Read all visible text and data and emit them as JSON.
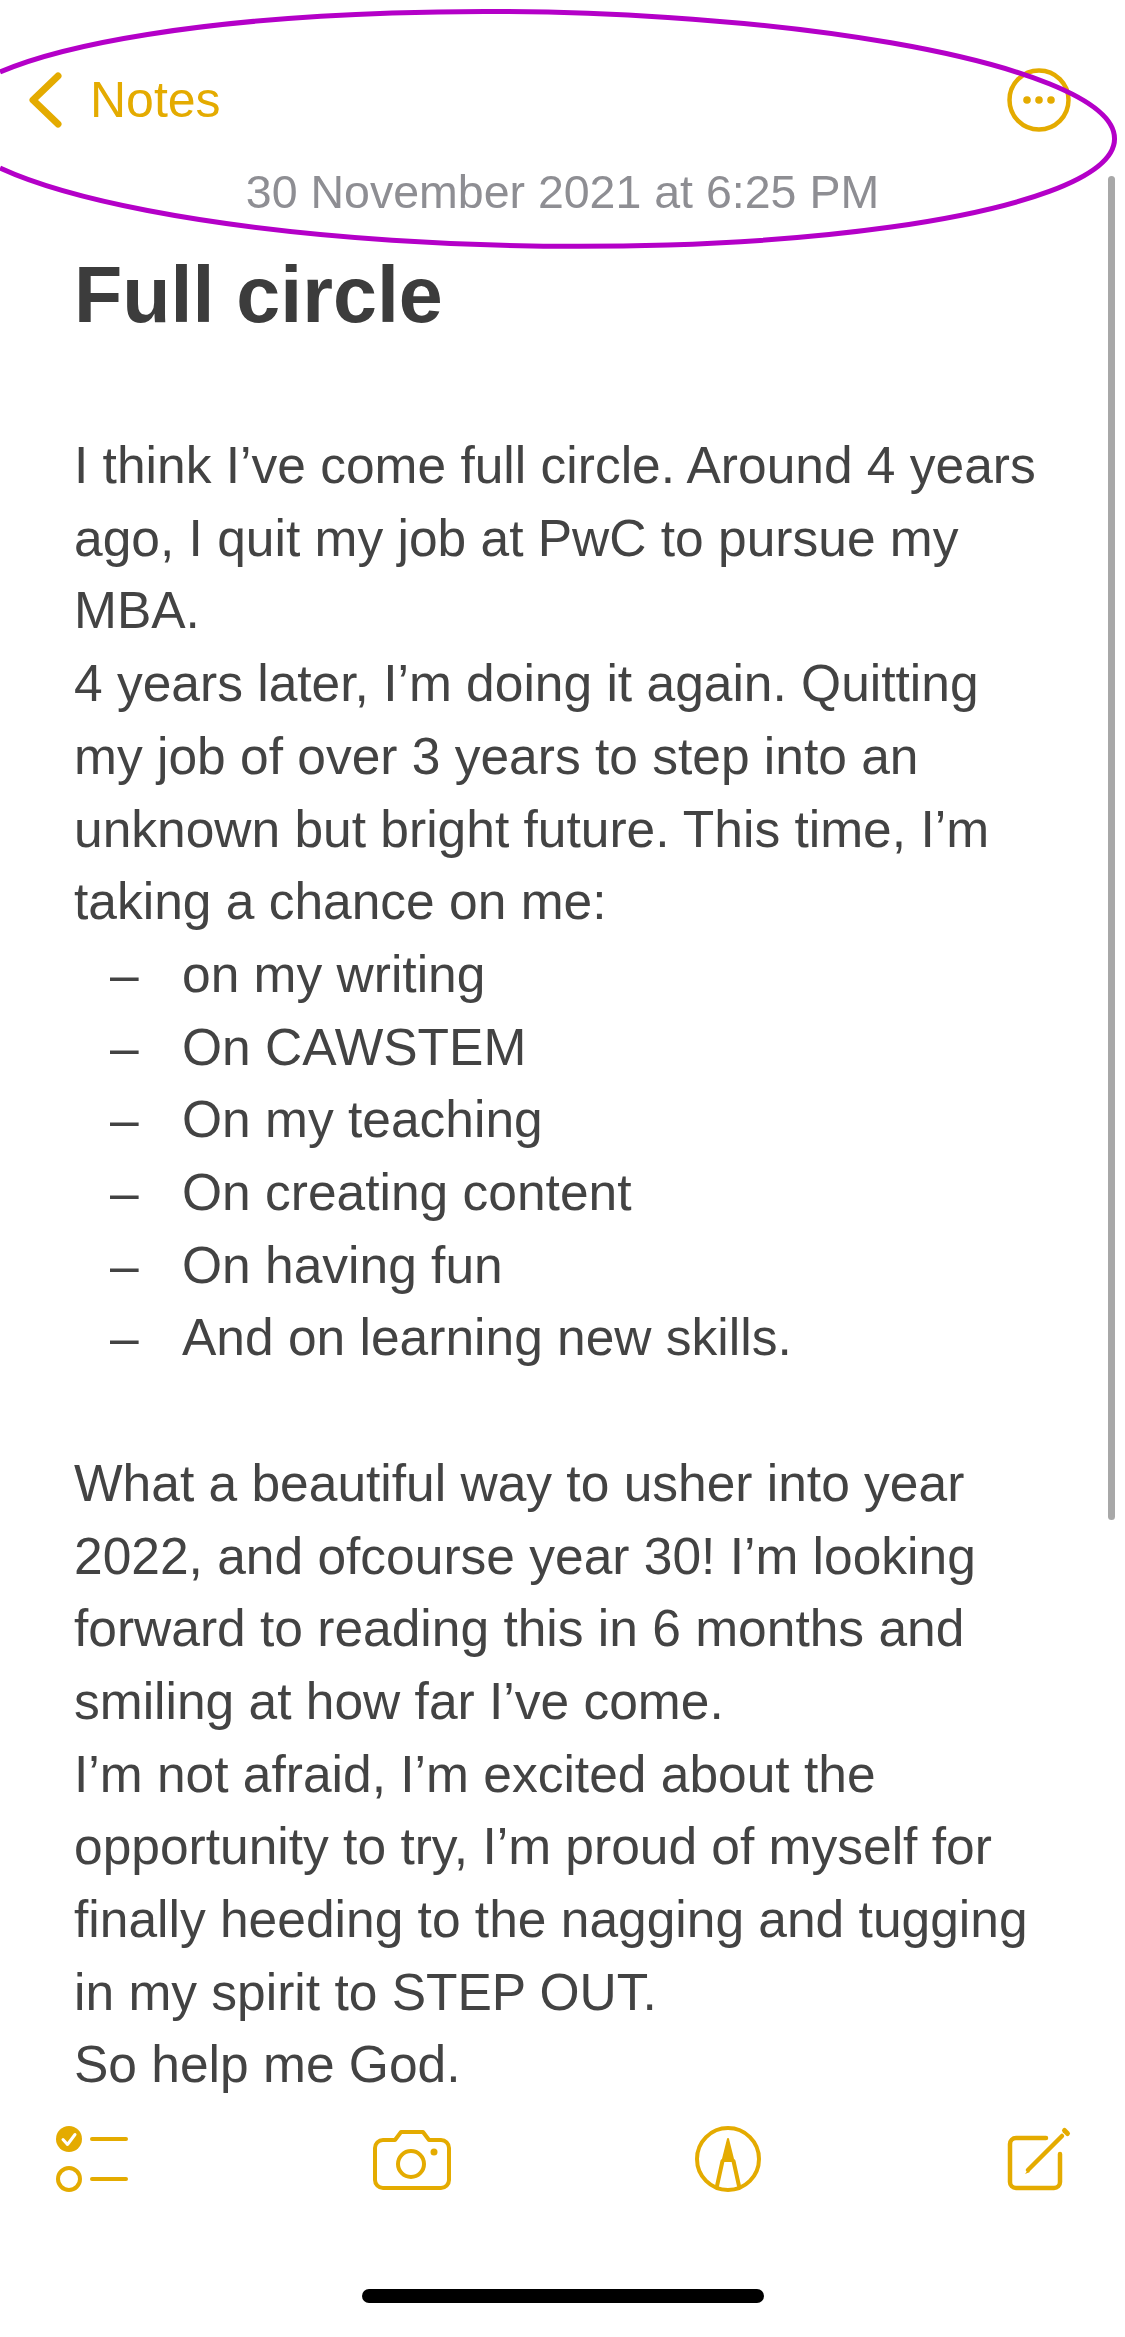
{
  "nav_bar": {
    "back_label": "Notes"
  },
  "note": {
    "date": "30 November 2021 at 6:25 PM",
    "title": "Full circle",
    "body": [
      {
        "kind": "paragraph",
        "text": "I think I’ve come full circle. Around 4 years ago, I quit my job at PwC to pursue my MBA."
      },
      {
        "kind": "paragraph",
        "text": "4 years later, I’m doing it again. Quitting my job of over 3 years to step into an unknown but bright future. This time, I’m taking a chance on me:"
      },
      {
        "kind": "list",
        "marker": "–",
        "items": [
          "on my writing",
          "On CAWSTEM",
          "On my teaching",
          "On creating content",
          "On having fun",
          "And on learning new skills."
        ]
      },
      {
        "kind": "paragraph",
        "text": "What a beautiful way to usher into year 2022, and ofcourse year 30! I’m looking forward to reading this in 6 months and smiling at how far I’ve come."
      },
      {
        "kind": "paragraph",
        "text": "I’m not afraid, I’m excited about the opportunity to try, I’m proud of myself for finally heeding to the nagging and tugging in my spirit to STEP OUT."
      },
      {
        "kind": "paragraph",
        "text": "So help me God."
      }
    ]
  }
}
